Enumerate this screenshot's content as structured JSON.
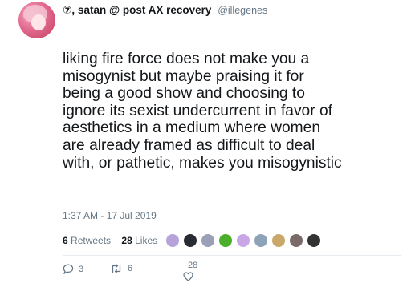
{
  "user": {
    "display_name": "⑦, satan @ post AX recovery",
    "handle": "@illegenes"
  },
  "tweet": {
    "lines": [
      "liking fire force does not make you a",
      "misogynist but maybe praising it for",
      "being a good show and choosing to",
      "ignore its sexist undercurrent in favor of",
      "aesthetics in a medium where women",
      "are already framed as difficult to deal",
      "with, or pathetic, makes you misogynistic"
    ],
    "timestamp": "1:37 AM - 17 Jul 2019"
  },
  "stats": {
    "retweets_count": "6",
    "retweets_label": "Retweets",
    "likes_count": "28",
    "likes_label": "Likes"
  },
  "likers": [
    {
      "icon": "liker-avatar",
      "color": "#b7a3d9"
    },
    {
      "icon": "liker-avatar",
      "color": "#2b2b33"
    },
    {
      "icon": "liker-avatar",
      "color": "#9aa0b8"
    },
    {
      "icon": "liker-avatar",
      "color": "#4caf2a"
    },
    {
      "icon": "liker-avatar",
      "color": "#c9a7e6"
    },
    {
      "icon": "liker-avatar",
      "color": "#8fa3b8"
    },
    {
      "icon": "liker-avatar",
      "color": "#c9a86a"
    },
    {
      "icon": "liker-avatar",
      "color": "#7a6a6a"
    },
    {
      "icon": "liker-avatar",
      "color": "#333333"
    }
  ],
  "actions": {
    "replies": "3",
    "retweets": "6",
    "likes": "28"
  },
  "colors": {
    "text": "#14171a",
    "muted": "#657786",
    "divider": "#e6ecf0"
  }
}
